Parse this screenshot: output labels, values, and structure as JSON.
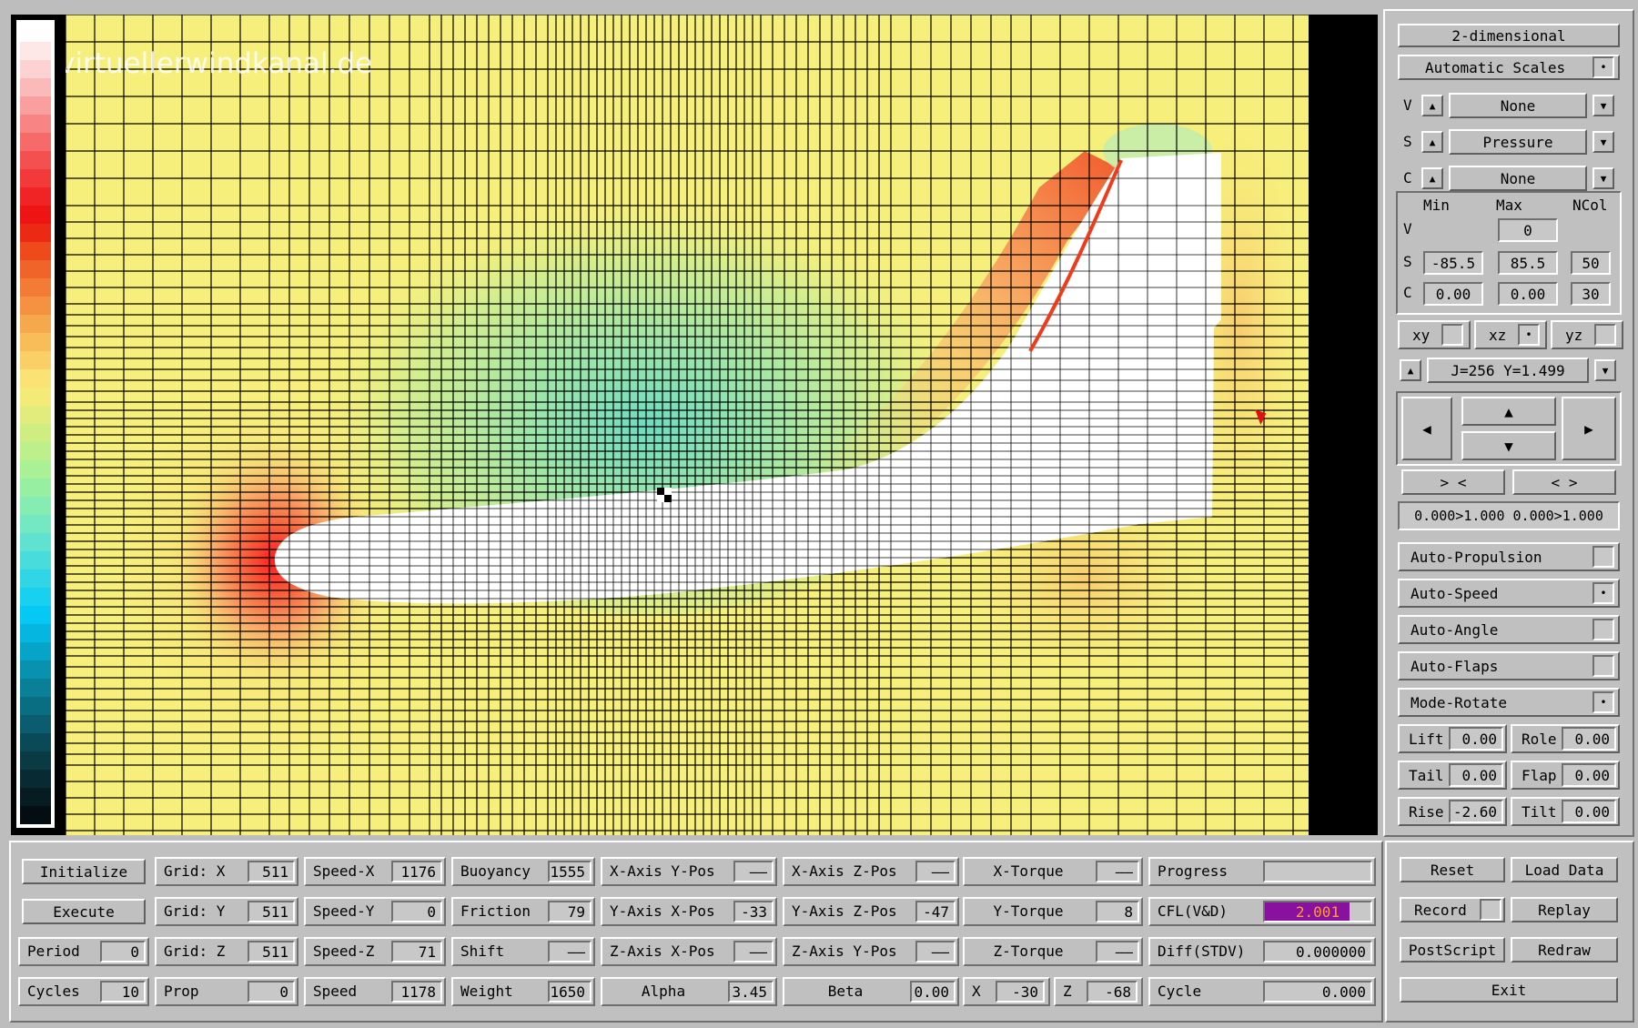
{
  "watermark": "virtuellerwindkanal.de",
  "colors": {
    "field_bg": "#f7ef7c",
    "grid_line": "#000000",
    "body_fill": "#ffffff",
    "stagnation": "#ff2a2a",
    "low_pressure": "#7fe0c0",
    "panel_bg": "#c0c0c0",
    "cfl_bar": "#8a10a0"
  },
  "legend_colors": [
    "#ffffff",
    "#fde7e7",
    "#fcd2d2",
    "#fbbaba",
    "#fa9f9f",
    "#f98484",
    "#f76a6a",
    "#f55050",
    "#f33a3a",
    "#f02424",
    "#ee1414",
    "#ec2a14",
    "#ee4a1c",
    "#f0642a",
    "#f27c36",
    "#f49242",
    "#f6a84c",
    "#f8bc58",
    "#fad066",
    "#fbe274",
    "#f3ea78",
    "#e2ec7c",
    "#cfee82",
    "#bdf08a",
    "#a9f194",
    "#97f0a2",
    "#86edb2",
    "#74e8c2",
    "#60e2d0",
    "#48dcdc",
    "#30d6e6",
    "#18d0ef",
    "#06c8f4",
    "#04b6e0",
    "#06a4c8",
    "#0892b0",
    "#0a8098",
    "#0a6e82",
    "#0a5c6e",
    "#0a4a58",
    "#0a3a44",
    "#082a32",
    "#061c22",
    "#040e12"
  ],
  "right_panel": {
    "view_mode": "2-dimensional",
    "auto_scales": {
      "label": "Automatic Scales",
      "mark": "•"
    },
    "channels": [
      {
        "key": "V",
        "value": "None"
      },
      {
        "key": "S",
        "value": "Pressure"
      },
      {
        "key": "C",
        "value": "None"
      }
    ],
    "scale_headers": {
      "min": "Min",
      "max": "Max",
      "ncol": "NCol"
    },
    "scale_rows": {
      "v": {
        "key": "V",
        "max": "0"
      },
      "s": {
        "key": "S",
        "min": "-85.5",
        "max": "85.5",
        "ncol": "50"
      },
      "c": {
        "key": "C",
        "min": "0.00",
        "max": "0.00",
        "ncol": "30"
      }
    },
    "planes": [
      {
        "label": "xy",
        "mark": ""
      },
      {
        "label": "xz",
        "mark": "•"
      },
      {
        "label": "yz",
        "mark": ""
      }
    ],
    "slice_label": "J=256  Y=1.499",
    "zoom_in_label": "> <",
    "zoom_out_label": "< >",
    "range_text": "0.000>1.000 0.000>1.000",
    "toggles": [
      {
        "label": "Auto-Propulsion",
        "mark": ""
      },
      {
        "label": "Auto-Speed",
        "mark": "•"
      },
      {
        "label": "Auto-Angle",
        "mark": ""
      },
      {
        "label": "Auto-Flaps",
        "mark": ""
      },
      {
        "label": "Mode-Rotate",
        "mark": "•"
      }
    ],
    "params": {
      "lift": {
        "label": "Lift",
        "value": "0.00"
      },
      "role": {
        "label": "Role",
        "value": "0.00"
      },
      "tail": {
        "label": "Tail",
        "value": "0.00"
      },
      "flap": {
        "label": "Flap",
        "value": "0.00"
      },
      "rise": {
        "label": "Rise",
        "value": "-2.60"
      },
      "tilt": {
        "label": "Tilt",
        "value": "0.00"
      }
    }
  },
  "bottom": {
    "initialize": "Initialize",
    "execute": "Execute",
    "period": {
      "label": "Period",
      "value": "0"
    },
    "cycles": {
      "label": "Cycles",
      "value": "10"
    },
    "grid_x": {
      "label": "Grid: X",
      "value": "511"
    },
    "grid_y": {
      "label": "Grid: Y",
      "value": "511"
    },
    "grid_z": {
      "label": "Grid: Z",
      "value": "511"
    },
    "prop": {
      "label": "Prop",
      "value": "0"
    },
    "speed_x": {
      "label": "Speed-X",
      "value": "1176"
    },
    "speed_y": {
      "label": "Speed-Y",
      "value": "0"
    },
    "speed_z": {
      "label": "Speed-Z",
      "value": "71"
    },
    "speed": {
      "label": "Speed",
      "value": "1178"
    },
    "buoyancy": {
      "label": "Buoyancy",
      "value": "1555"
    },
    "friction": {
      "label": "Friction",
      "value": "79"
    },
    "shift": {
      "label": "Shift",
      "value": "——"
    },
    "weight": {
      "label": "Weight",
      "value": "1650"
    },
    "xaxis_ypos": {
      "label": "X-Axis Y-Pos",
      "value": "——"
    },
    "yaxis_xpos": {
      "label": "Y-Axis X-Pos",
      "value": "-33"
    },
    "zaxis_xpos": {
      "label": "Z-Axis X-Pos",
      "value": "——"
    },
    "alpha": {
      "label": "Alpha",
      "value": "3.45"
    },
    "xaxis_zpos": {
      "label": "X-Axis Z-Pos",
      "value": "——"
    },
    "yaxis_zpos": {
      "label": "Y-Axis Z-Pos",
      "value": "-47"
    },
    "zaxis_ypos": {
      "label": "Z-Axis Y-Pos",
      "value": "——"
    },
    "beta": {
      "label": "Beta",
      "value": "0.00"
    },
    "x_torque": {
      "label": "X-Torque",
      "value": "——"
    },
    "y_torque": {
      "label": "Y-Torque",
      "value": "8"
    },
    "z_torque": {
      "label": "Z-Torque",
      "value": "——"
    },
    "x": {
      "label": "X",
      "value": "-30"
    },
    "z": {
      "label": "Z",
      "value": "-68"
    },
    "progress": {
      "label": "Progress",
      "value": ""
    },
    "cfl": {
      "label": "CFL(V&D)",
      "value": "2.001"
    },
    "diff": {
      "label": "Diff(STDV)",
      "value": "0.000000"
    },
    "cycle": {
      "label": "Cycle",
      "value": "0.000"
    },
    "reset": "Reset",
    "load_data": "Load Data",
    "record": "Record",
    "replay": "Replay",
    "postscript": "PostScript",
    "redraw": "Redraw",
    "exit": "Exit"
  }
}
